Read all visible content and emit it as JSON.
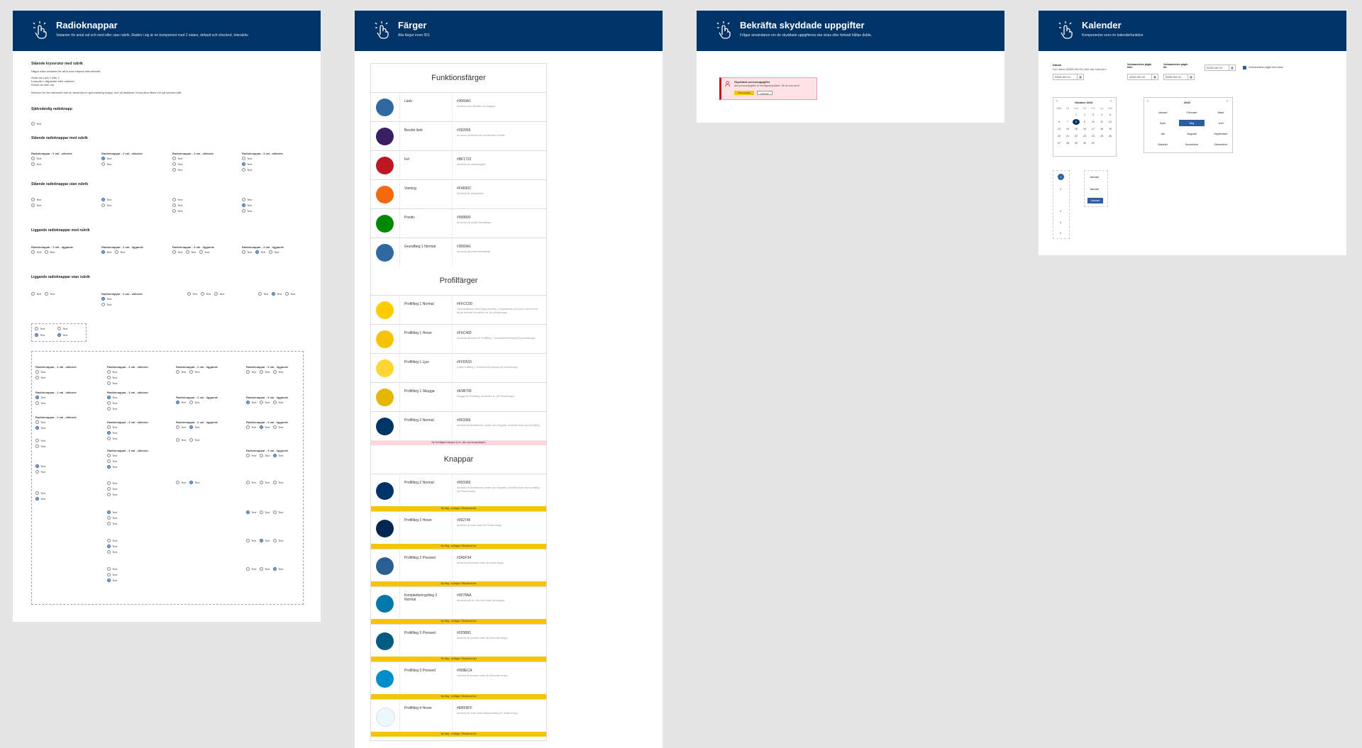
{
  "frames": [
    {
      "title": "Radioknappar",
      "subtitle": "Varianter för antal val och med eller utan rubrik. Raden i sig är en komponent med 2 states, default och checked. Interaktiv."
    },
    {
      "title": "Färger",
      "subtitle": "Alla färger inom IDS"
    },
    {
      "title": "Bekräfta skyddade uppgifter",
      "subtitle": "Frågar användaren om de skyddade uppgifterna ska visas eller fortsatt hållas dolda."
    },
    {
      "title": "Kalender",
      "subtitle": "Komponenter som rör kalenderfunktion"
    }
  ],
  "radio": {
    "intro_title": "Stående kryssrutor med rubrik",
    "intro_lines": [
      "Några olika varianter för att kunna erbjuda interaktivitet.",
      "Antal val (-dej 1 eller 2",
      "Kompakt i vågvärdet eller rubriken",
      "Rubrik av eller nej",
      "Behöver du fler alternativ kan du använda en grönvänstrig knapp, och så fastlärna. Korta dina fliken och på samma sätt."
    ],
    "s1": "Självständig radioknapp",
    "s2": "Stående radioknappar med rubrik",
    "s3": "Stående radioknappar utan rubrik",
    "s4": "Liggande radioknappar med rubrik",
    "s5": "Liggande radioknappar utan rubrik",
    "opt": "Text",
    "lbl_st1": "Radioknappar - 2 val - stående",
    "lbl_st2": "Radioknappar - 2 val - stående",
    "lbl_st3": "Radioknappar - 3 val - stående",
    "lbl_st4": "Radioknappar - 3 val - stående",
    "lbl_lg1": "Radioknappar - 2 val - liggande",
    "lbl_lg2": "Radioknappar - 2 val - liggande",
    "lbl_lg3": "Radioknappar - 3 val - liggande",
    "lbl_lg4": "Radioknappar - 3 val - liggande",
    "lbl_misc": "Radioknappar - 2 val - stående"
  },
  "colors": {
    "sections": [
      "Funktionsfärger",
      "Profilfärger",
      "Knappar"
    ],
    "functional": [
      {
        "name": "Länk",
        "hex": "#3069A1",
        "desc": "Används som blå länk och knappar.",
        "color": "#3069A1"
      },
      {
        "name": "Besökt länk",
        "hex": "#392065",
        "desc": "Används på länkar som användaren besökt.",
        "color": "#392065"
      },
      {
        "name": "Fel",
        "hex": "#BF1722",
        "desc": "Används för valideringsfel.",
        "color": "#BF1722"
      },
      {
        "name": "Varning",
        "hex": "#F4690C",
        "desc": "Används för viktighetsfel.",
        "color": "#F4690C"
      },
      {
        "name": "Positiv",
        "hex": "#008800",
        "desc": "Används vid positiv bekräftelse.",
        "color": "#008800"
      },
      {
        "name": "Grundfärg 1 Normal",
        "hex": "#3069A1",
        "desc": "Används på positiv bekräftelse.",
        "color": "#3069A1"
      }
    ],
    "profile": [
      {
        "name": "Profilfärg 1 Normal",
        "hex": "#FFCC00",
        "desc": "Till illustrationer samt bakgrundsfärg. Kompletteras vid behov med text för att ge kontrast. Används t.ex. för primärknapp.",
        "color": "#FFCC00"
      },
      {
        "name": "Profilfärg 1 Hover",
        "hex": "#F5C400",
        "desc": "Används på hover för Profilfärg 1. Används till exempel på primärknapp.",
        "color": "#F5C400"
      },
      {
        "name": "Profilfärg 1 Ljus",
        "hex": "#FFD633",
        "desc": "Ljusa Profilfärg 1. Används till exempel på primärknapp.",
        "color": "#FFD633"
      },
      {
        "name": "Profilfärg 1 Skugga",
        "hex": "#E5B700",
        "desc": "Skugga för Profilfärg. Används t.ex. på Primärknapp.",
        "color": "#E5B700"
      },
      {
        "name": "Profilfärg 2 Normal",
        "hex": "#003366",
        "desc": "Används till illustrationer, grafer och infografik. Används även som profilfärg.",
        "color": "#003366"
      }
    ],
    "new_category_note": "Ny förmågan kategori (t.ex. alla nya knappfärger)",
    "buttons": [
      {
        "name": "Profilfärg 2 Normal",
        "hex": "#003366",
        "desc": "Används till illustrationer, grafer och infografik. Används även som profilfärg på Primär knapp.",
        "color": "#003366"
      },
      {
        "name": "Profilfärg 2 Hover",
        "hex": "#00274F",
        "desc": "Används till hover state för Primär knapp.",
        "color": "#00274F"
      },
      {
        "name": "Profilfärg 2 Pressed",
        "hex": "#2A5F94",
        "desc": "Används till pressed state på primär knapp.",
        "color": "#2A5F94"
      },
      {
        "name": "Kompletteringsfärg 3 Normal",
        "hex": "#0078AA",
        "desc": "Används på t.ex. till hover state på knappar.",
        "color": "#0078AA"
      },
      {
        "name": "Profilfärg 3 Pressed",
        "hex": "#025B81",
        "desc": "Används till pressed state på Sekundär knapp.",
        "color": "#025B81"
      },
      {
        "name": "Profilfärg 3 Pressed",
        "hex": "#008ECA",
        "desc": "Används till pressed state på Sekundär knapp.",
        "color": "#008ECA"
      },
      {
        "name": "Profilfärg 4 Hover",
        "hex": "#EBF9FF",
        "desc": "Används till hover state bakgrundsfärg för Tertiär knapp.",
        "color": "#EBF9FF"
      }
    ],
    "new_note": "Ny färg - ej tilagd i Storybook än"
  },
  "protected": {
    "box_title": "Skyddade personuppgifter",
    "box_text": "Alla personuppgifter är hemliga/skyddade. Vill du visa dem?",
    "show_button": "Visa uppgifter",
    "hide_button": "Visa inte"
  },
  "calendar": {
    "field1_label": "Datum",
    "field1_hint": "Fyll i datum (ÅÅÅÅ-MM-DD) eller välj i kalendern",
    "field2_label": "Verksamheten pågår från:",
    "field3_label": "Verksamheten pågår till:",
    "placeholder": "ÅÅÅÅ-MM-DD",
    "checkbox_label": "Verksamheten pågår tills vidare",
    "month_title": "Oktober 2019",
    "weekdays": [
      "Mån",
      "Tis",
      "Ons",
      "Tor",
      "Fre",
      "Lör",
      "Sön"
    ],
    "days": [
      "",
      "",
      "1",
      "2",
      "3",
      "4",
      "5",
      "6",
      "7",
      "8",
      "9",
      "10",
      "11",
      "12",
      "13",
      "14",
      "15",
      "16",
      "17",
      "18",
      "19",
      "20",
      "21",
      "22",
      "23",
      "24",
      "25",
      "26",
      "27",
      "28",
      "29",
      "30",
      "31",
      "",
      "",
      ""
    ],
    "selected_day": "8",
    "year_title": "2020",
    "months": [
      "Januari",
      "Februari",
      "Mars",
      "April",
      "Maj",
      "Juni",
      "Juli",
      "Augusti",
      "September",
      "Oktober",
      "November",
      "December"
    ],
    "selected_month": "Maj",
    "small_items": [
      "Januari",
      "Januari",
      "Januari"
    ],
    "small_numbers": [
      "1",
      "1",
      "1",
      "1",
      "1"
    ]
  }
}
